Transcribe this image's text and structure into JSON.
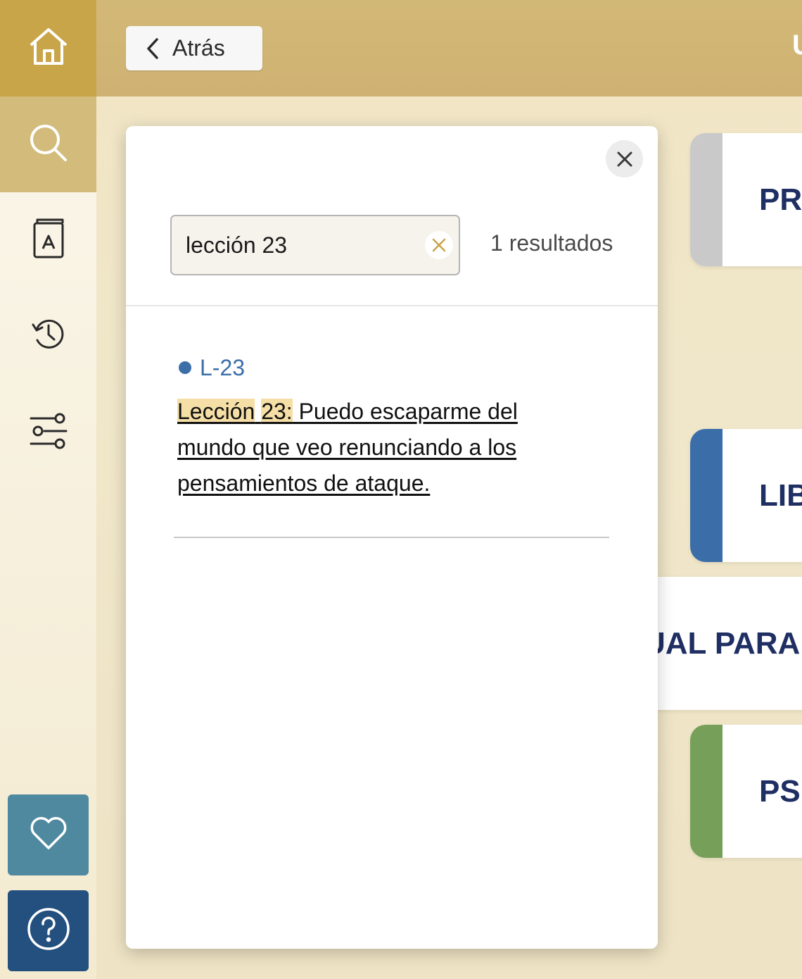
{
  "header": {
    "back_label": "Atrás",
    "title_stub": "U"
  },
  "sidebar": {
    "items": [
      {
        "name": "home",
        "icon": "home-icon",
        "active": false
      },
      {
        "name": "search",
        "icon": "search-icon",
        "active": true
      },
      {
        "name": "dictionary",
        "icon": "dictionary-book-icon",
        "active": false
      },
      {
        "name": "history",
        "icon": "history-icon",
        "active": false
      },
      {
        "name": "settings",
        "icon": "sliders-icon",
        "active": false
      },
      {
        "name": "favorites",
        "icon": "heart-icon",
        "active": false
      },
      {
        "name": "help",
        "icon": "help-icon",
        "active": false
      }
    ]
  },
  "search": {
    "query": "lección 23",
    "result_count_text": "1 resultados"
  },
  "results": [
    {
      "reference": "L-23",
      "highlight_1": "Lección",
      "highlight_2": "23:",
      "rest": "Puedo escaparme del mundo que veo renunciando a los pensamientos de ataque."
    }
  ],
  "background_cards": [
    {
      "title": "PRI",
      "stripe_color": "#c9c9c9"
    },
    {
      "title": "LIB",
      "stripe_color": "#3b6ea8"
    },
    {
      "title": "UAL PARA E",
      "stripe_color": "#ffffff"
    },
    {
      "title": "PSI",
      "stripe_color": "#76a05a"
    }
  ],
  "colors": {
    "accent_gold": "#c9a54a",
    "header_gold": "#d2b876",
    "favorites_teal": "#4f89a0",
    "help_navy": "#23507f",
    "title_navy": "#1f2e63",
    "link_blue": "#3c6ea8",
    "highlight": "#f6dfa6"
  }
}
